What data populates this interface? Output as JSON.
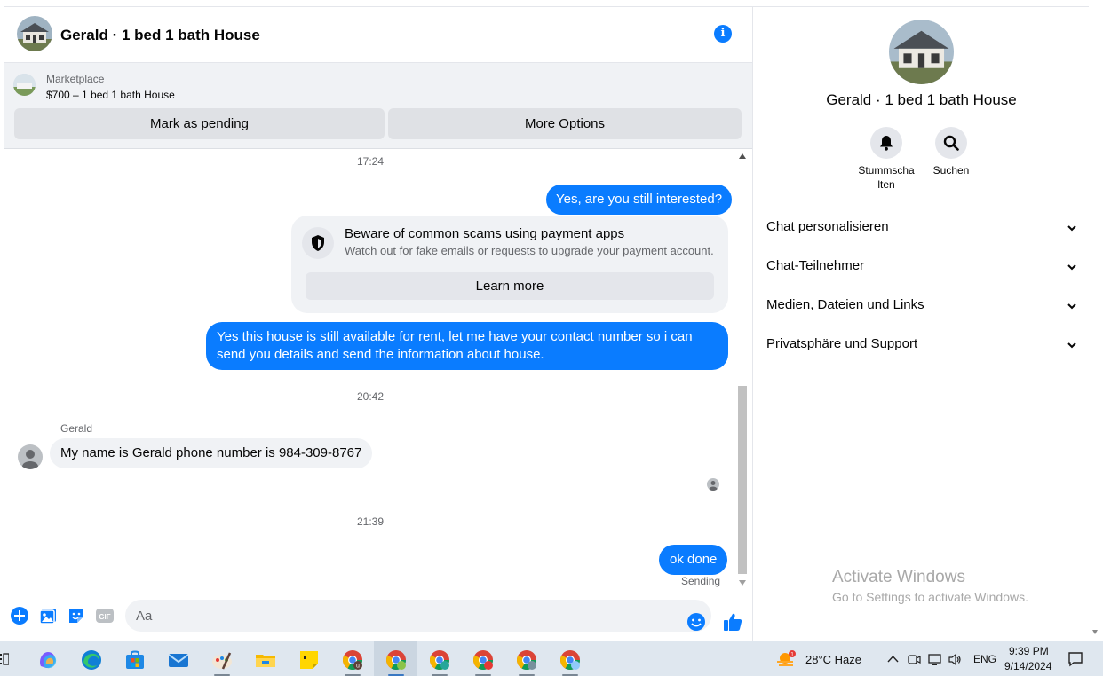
{
  "chat": {
    "title": "Gerald · 1 bed 1 bath House",
    "marketplace": {
      "label": "Marketplace",
      "listing": "$700 – 1 bed 1 bath House",
      "pending_button": "Mark as pending",
      "options_button": "More Options"
    },
    "messages": {
      "ts1": "17:24",
      "out1": "Yes, are you still interested?",
      "warning_title": "Beware of common scams using payment apps",
      "warning_sub": "Watch out for fake emails or requests to upgrade your payment account.",
      "learn_more": "Learn more",
      "out2_line1": "Yes this house is still available for rent, let me have your contact number so i can",
      "out2_line2": "send you details and send the information about house.",
      "ts2": "20:42",
      "sender": "Gerald",
      "in1": "My name  is  Gerald  phone  number  is 984-309-8767",
      "ts3": "21:39",
      "out3": "ok done",
      "status": "Sending"
    },
    "composer": {
      "placeholder": "Aa"
    }
  },
  "right_panel": {
    "title": "Gerald · 1 bed 1 bath House",
    "mute_label_1": "Stummscha",
    "mute_label_2": "lten",
    "search_label": "Suchen",
    "sections": [
      "Chat personalisieren",
      "Chat-Teilnehmer",
      "Medien, Dateien und Links",
      "Privatsphäre und Support"
    ]
  },
  "watermark": {
    "title": "Activate Windows",
    "sub": "Go to Settings to activate Windows."
  },
  "taskbar": {
    "weather": "28°C  Haze",
    "weather_badge": "1",
    "lang": "ENG",
    "time": "9:39 PM",
    "date": "9/14/2024",
    "chrome_badge": "u"
  },
  "colors": {
    "accent": "#0a7cff",
    "bubble_in": "#f0f2f5",
    "muted_text": "#65676b"
  }
}
